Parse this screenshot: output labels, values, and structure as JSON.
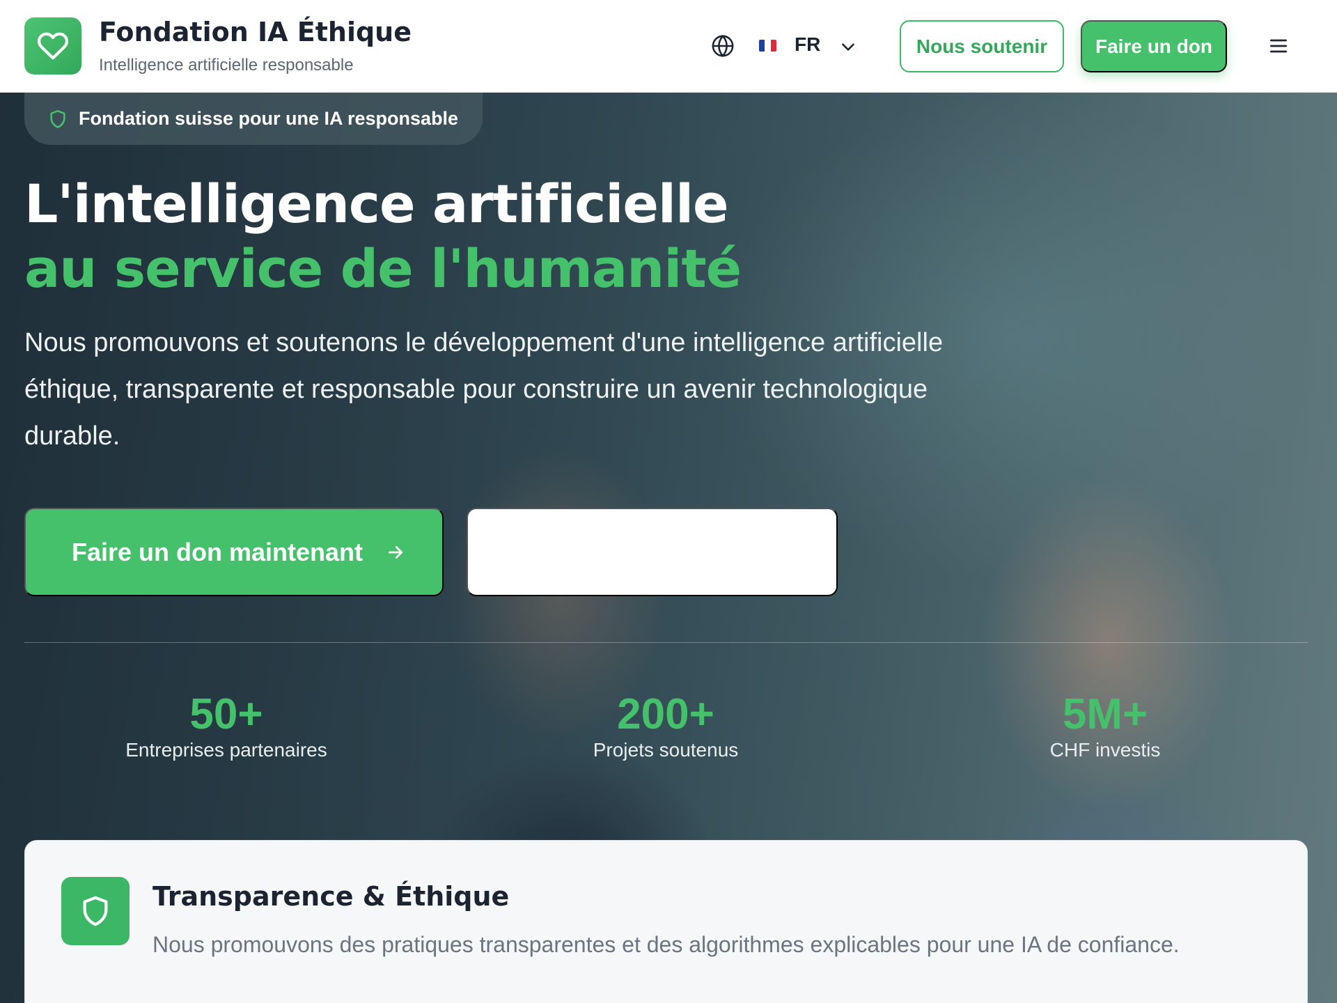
{
  "header": {
    "brand_title": "Fondation IA Éthique",
    "brand_subtitle": "Intelligence artificielle responsable",
    "logo_icon": "heart-icon",
    "language": "FR",
    "support_label": "Nous soutenir",
    "donate_label": "Faire un don"
  },
  "hero": {
    "badge": "Fondation suisse pour une IA responsable",
    "title_line1": "L'intelligence artificielle",
    "title_line2": "au service de l'humanité",
    "description": "Nous promouvons et soutenons le développement d'une intelligence artificielle éthique, transparente et responsable pour construire un avenir technologique durable.",
    "primary_cta": "Faire un don maintenant",
    "secondary_cta": ""
  },
  "stats": [
    {
      "value": "50+",
      "label": "Entreprises partenaires"
    },
    {
      "value": "200+",
      "label": "Projets soutenus"
    },
    {
      "value": "5M+",
      "label": "CHF investis"
    }
  ],
  "feature_card": {
    "icon": "shield-icon",
    "title": "Transparence & Éthique",
    "description": "Nous promouvons des pratiques transparentes et des algorithmes explicables pour une IA de confiance."
  },
  "colors": {
    "accent": "#45c06b",
    "text_dark": "#1c2431"
  }
}
